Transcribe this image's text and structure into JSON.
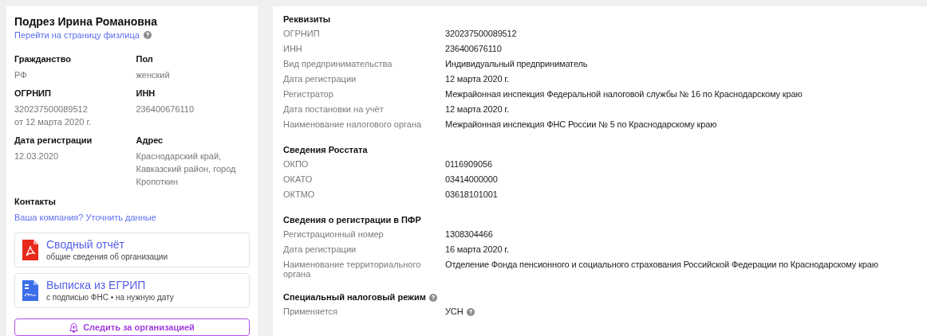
{
  "person": {
    "name": "Подрез Ирина Романовна",
    "link": "Перейти на страницу физлица"
  },
  "facts": [
    {
      "label": "Гражданство",
      "lines": [
        "РФ"
      ]
    },
    {
      "label": "Пол",
      "lines": [
        "женский"
      ]
    },
    {
      "label": "ОГРНИП",
      "lines": [
        "320237500089512",
        "от 12 марта 2020 г."
      ]
    },
    {
      "label": "ИНН",
      "lines": [
        "236400676110"
      ]
    },
    {
      "label": "Дата регистрации",
      "lines": [
        "12.03.2020"
      ]
    },
    {
      "label": "Адрес",
      "lines": [
        "Краснодарский край, Кавказский район, город Кропоткин"
      ]
    }
  ],
  "contacts": {
    "title": "Контакты",
    "link": "Ваша компания? Уточнить данные"
  },
  "documents": [
    {
      "kind": "pdf",
      "title": "Сводный отчёт",
      "subtitle": "общие сведения об организации"
    },
    {
      "kind": "signed",
      "title": "Выписка из ЕГРИП",
      "subtitle": "с подписью ФНС • на нужную дату"
    }
  ],
  "follow_button": "Следить за организацией",
  "sections": [
    {
      "title": "Реквизиты",
      "help": false,
      "rows": [
        {
          "label": "ОГРНИП",
          "value": "320237500089512"
        },
        {
          "label": "ИНН",
          "value": "236400676110"
        },
        {
          "label": "Вид предпринимательства",
          "value": "Индивидуальный предприниматель"
        },
        {
          "label": "Дата регистрации",
          "value": "12 марта 2020 г."
        },
        {
          "label": "Регистратор",
          "value": "Межрайонная инспекция Федеральной налоговой службы № 16 по Краснодарскому краю"
        },
        {
          "label": "Дата постановки на учёт",
          "value": "12 марта 2020 г."
        },
        {
          "label": "Наименование налогового органа",
          "value": "Межрайонная инспекция ФНС России № 5 по Краснодарскому краю"
        }
      ]
    },
    {
      "title": "Сведения Росстата",
      "help": false,
      "rows": [
        {
          "label": "ОКПО",
          "value": "0116909056"
        },
        {
          "label": "ОКАТО",
          "value": "03414000000"
        },
        {
          "label": "ОКТМО",
          "value": "03618101001"
        }
      ]
    },
    {
      "title": "Сведения о регистрации в ПФР",
      "help": false,
      "rows": [
        {
          "label": "Регистрационный номер",
          "value": "1308304466"
        },
        {
          "label": "Дата регистрации",
          "value": "16 марта 2020 г."
        },
        {
          "label": "Наименование территориального органа",
          "value": "Отделение Фонда пенсионного и социального страхования Российской Федерации по Краснодарскому краю"
        }
      ]
    },
    {
      "title": "Специальный налоговый режим",
      "help": true,
      "rows": [
        {
          "label": "Применяется",
          "value": "УСН",
          "help": true
        }
      ]
    }
  ]
}
